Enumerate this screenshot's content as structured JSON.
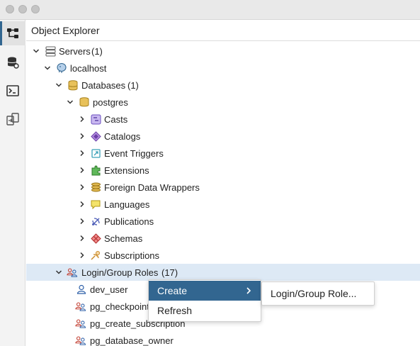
{
  "window": {
    "controls": [
      "close",
      "minimize",
      "maximize"
    ]
  },
  "sidebar": {
    "buttons": [
      {
        "icon": "object-explorer-icon",
        "active": true
      },
      {
        "icon": "query-tool-icon",
        "active": false
      },
      {
        "icon": "psql-tool-icon",
        "active": false
      },
      {
        "icon": "schema-diff-icon",
        "active": false
      }
    ]
  },
  "panel": {
    "title": "Object Explorer"
  },
  "tree": {
    "servers": {
      "label": "Servers",
      "count": "(1)"
    },
    "localhost": {
      "label": "localhost"
    },
    "databases": {
      "label": "Databases",
      "count": "(1)"
    },
    "postgres": {
      "label": "postgres"
    },
    "children": [
      {
        "label": "Casts",
        "icon": "casts-icon"
      },
      {
        "label": "Catalogs",
        "icon": "catalogs-icon"
      },
      {
        "label": "Event Triggers",
        "icon": "event-triggers-icon"
      },
      {
        "label": "Extensions",
        "icon": "extensions-icon"
      },
      {
        "label": "Foreign Data Wrappers",
        "icon": "foreign-data-wrappers-icon"
      },
      {
        "label": "Languages",
        "icon": "languages-icon"
      },
      {
        "label": "Publications",
        "icon": "publications-icon"
      },
      {
        "label": "Schemas",
        "icon": "schemas-icon"
      },
      {
        "label": "Subscriptions",
        "icon": "subscriptions-icon"
      }
    ],
    "roles": {
      "label": "Login/Group Roles",
      "count": "(17)"
    },
    "role_items": [
      {
        "label": "dev_user",
        "icon": "user-icon"
      },
      {
        "label": "pg_checkpoint",
        "icon": "group-role-icon"
      },
      {
        "label": "pg_create_subscription",
        "icon": "group-role-icon"
      },
      {
        "label": "pg_database_owner",
        "icon": "group-role-icon"
      }
    ]
  },
  "context_menu": {
    "items": [
      {
        "label": "Create",
        "highlighted": true,
        "has_submenu": true
      },
      {
        "label": "Refresh",
        "highlighted": false,
        "has_submenu": false
      }
    ],
    "submenu": {
      "items": [
        {
          "label": "Login/Group Role..."
        }
      ]
    }
  },
  "colors": {
    "accent": "#326690",
    "selected_row": "#dde9f5"
  }
}
